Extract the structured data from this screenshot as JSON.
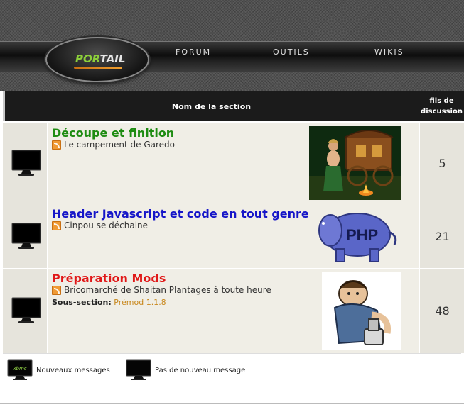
{
  "header": {
    "logo": {
      "part1": "POR",
      "part2": "TAIL"
    },
    "nav": [
      {
        "label": "FORUM"
      },
      {
        "label": "OUTILS"
      },
      {
        "label": "WIKIS"
      }
    ]
  },
  "table": {
    "col_name": "Nom de la section",
    "col_count_line1": "fils de",
    "col_count_line2": "discussion"
  },
  "forums": [
    {
      "title": "Découpe et finition",
      "title_color": "#1e8c12",
      "last_topic": "Le campement de Garedo",
      "count": "5",
      "image_icon": "gypsy-caravan-image"
    },
    {
      "title": "Header Javascript et code en tout genre",
      "title_color": "#1616c8",
      "last_topic": "Cinpou se déchaine",
      "count": "21",
      "image_icon": "php-elephant-image"
    },
    {
      "title": "Préparation Mods",
      "title_color": "#e01818",
      "last_topic": "Bricomarché de Shaitan Plantages à toute heure",
      "subsection_label": "Sous-section:",
      "subsection_link": "Prémod 1.1.8",
      "count": "48",
      "image_icon": "mechanic-cartoon-image"
    }
  ],
  "legend": {
    "new_messages": "Nouveaux messages",
    "no_new_messages": "Pas de nouveau message",
    "new_icon_text": "xbmc"
  },
  "colors": {
    "row_bg": "#f0eee6",
    "header_bg": "#1b1b1b",
    "accent_orange": "#e08a20"
  }
}
